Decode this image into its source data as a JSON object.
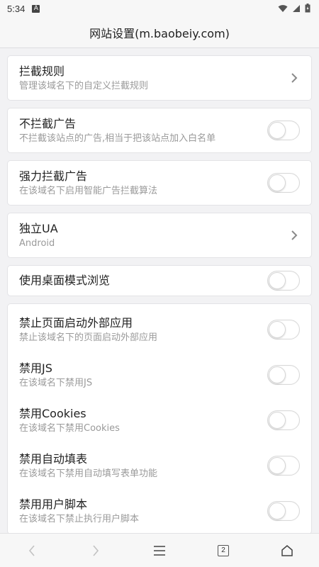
{
  "status_bar": {
    "time": "5:34",
    "notification_letter": "A"
  },
  "header": {
    "title": "网站设置(m.baobeiy.com)"
  },
  "cards": [
    {
      "rows": [
        {
          "label": "拦截规则",
          "sub": "管理该域名下的自定义拦截规则",
          "control": "chevron"
        }
      ]
    },
    {
      "rows": [
        {
          "label": "不拦截广告",
          "sub": "不拦截该站点的广告,相当于把该站点加入白名单",
          "control": "toggle",
          "on": false
        }
      ]
    },
    {
      "rows": [
        {
          "label": "强力拦截广告",
          "sub": "在该域名下启用智能广告拦截算法",
          "control": "toggle",
          "on": false
        }
      ]
    },
    {
      "rows": [
        {
          "label": "独立UA",
          "sub": "Android",
          "control": "chevron"
        }
      ]
    },
    {
      "rows": [
        {
          "label": "使用桌面模式浏览",
          "sub": "",
          "control": "toggle",
          "on": false
        }
      ]
    },
    {
      "rows": [
        {
          "label": "禁止页面启动外部应用",
          "sub": "禁止该域名下的页面启动外部应用",
          "control": "toggle",
          "on": false
        },
        {
          "label": "禁用JS",
          "sub": "在该域名下禁用JS",
          "control": "toggle",
          "on": false
        },
        {
          "label": "禁用Cookies",
          "sub": "在该域名下禁用Cookies",
          "control": "toggle",
          "on": false
        },
        {
          "label": "禁用自动填表",
          "sub": "在该域名下禁用自动填写表单功能",
          "control": "toggle",
          "on": false
        },
        {
          "label": "禁用用户脚本",
          "sub": "在该域名下禁止执行用户脚本",
          "control": "toggle",
          "on": false
        }
      ]
    }
  ],
  "bottom_bar": {
    "tab_count": "2"
  }
}
